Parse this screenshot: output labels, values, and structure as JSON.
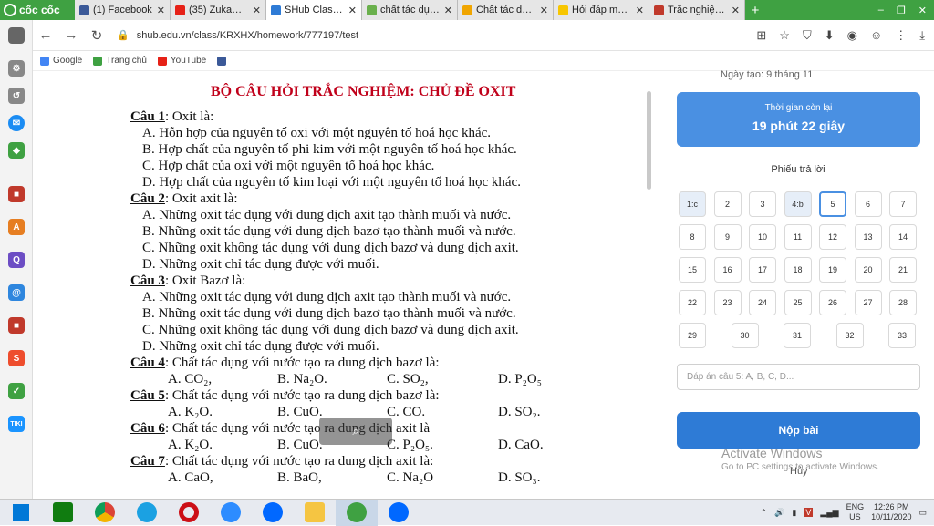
{
  "browser": {
    "brand": "cốc cốc",
    "tabs": [
      {
        "title": "(1) Facebook",
        "icon": "facebook-icon",
        "color": "#3b5998",
        "active": false
      },
      {
        "title": "(35) ZukaNoPro",
        "icon": "youtube-icon",
        "color": "#e62117",
        "active": false
      },
      {
        "title": "SHub Classroom",
        "icon": "shub-icon",
        "color": "#2e7bd6",
        "active": true
      },
      {
        "title": "chất tác dụng v",
        "icon": "leaf-icon",
        "color": "#6ab04c",
        "active": false
      },
      {
        "title": "Chất tác dụng",
        "icon": "tag-icon",
        "color": "#f0a500",
        "active": false
      },
      {
        "title": "Hỏi đáp môn H",
        "icon": "hoidap-icon",
        "color": "#f7c600",
        "active": false
      },
      {
        "title": "Trắc nghiệm: N",
        "icon": "quiz-icon",
        "color": "#c0392b",
        "active": false
      }
    ],
    "new_tab": "+",
    "url": "shub.edu.vn/class/KRXHX/homework/777197/test",
    "bookmarks": [
      {
        "label": "Google",
        "color": "#4285f4"
      },
      {
        "label": "Trang chủ",
        "color": "#3fa142"
      },
      {
        "label": "YouTube",
        "color": "#e62117"
      },
      {
        "label": "",
        "color": "#3b5998"
      }
    ]
  },
  "document": {
    "title": "BỘ CÂU HỎI TRẮC NGHIỆM: CHỦ ĐỀ OXIT",
    "questions": [
      {
        "label": "Câu 1",
        "text": ": Oxit là:",
        "options": [
          "A. Hỗn hợp của nguyên tố oxi với một nguyên tố hoá học khác.",
          "B. Hợp chất của nguyên tố phi kim với một nguyên tố hoá học khác.",
          "C. Hợp chất của oxi với một nguyên tố hoá học khác.",
          "D. Hợp chất của nguyên tố kim loại với một nguyên tố hoá học khác."
        ]
      },
      {
        "label": "Câu 2",
        "text": ": Oxit axit là:",
        "options": [
          "A. Những oxit tác dụng với dung dịch axit tạo thành muối và nước.",
          "B. Những oxit tác dụng với dung dịch bazơ tạo thành muối và nước.",
          "C. Những oxit không tác dụng với dung dịch bazơ và dung dịch axit.",
          "D. Những oxit chỉ tác dụng được với muối."
        ]
      },
      {
        "label": "Câu 3",
        "text": ": Oxit Bazơ là:",
        "options": [
          "A. Những oxit tác dụng với dung dịch axit tạo thành muối và nước.",
          "B. Những oxit tác dụng với dung dịch bazơ tạo thành muối và nước.",
          "C. Những oxit không tác dụng với dung dịch bazơ và dung dịch axit.",
          "D. Những oxit chỉ tác dụng được với muối."
        ]
      },
      {
        "label": "Câu 4",
        "text": ": Chất tác dụng với nước tạo ra dung dịch bazơ là:",
        "options": [
          "A. CO₂,",
          "B. Na₂O.",
          "C. SO₂,",
          "D. P₂O₅"
        ]
      },
      {
        "label": "Câu 5",
        "text": ": Chất tác dụng với nước tạo ra dung dịch bazơ là:",
        "options": [
          "A. K₂O.",
          "B. CuO.",
          "C. CO.",
          "D. SO₂."
        ]
      },
      {
        "label": "Câu 6",
        "text": ": Chất tác dụng với nước tạo ra dung dịch axit là",
        "options": [
          "A. K₂O.",
          "B. CuO.",
          "C. P₂O₅.",
          "D. CaO."
        ]
      },
      {
        "label": "Câu 7",
        "text": ": Chất tác dụng với nước tạo ra dung dịch axit là:",
        "options": [
          "A. CaO,",
          "B. BaO,",
          "C. Na₂O",
          "D. SO₃."
        ]
      }
    ]
  },
  "panel": {
    "created": "Ngày tạo: 9 tháng 11",
    "timer_label": "Thời gian còn lại",
    "timer_value": "19 phút 22 giây",
    "sheet_title": "Phiếu trả lời",
    "cells": [
      "1:c",
      "2",
      "3",
      "4:b",
      "5",
      "6",
      "7",
      "8",
      "9",
      "10",
      "11",
      "12",
      "13",
      "14",
      "15",
      "16",
      "17",
      "18",
      "19",
      "20",
      "21",
      "22",
      "23",
      "24",
      "25",
      "26",
      "27",
      "28",
      "29",
      "30",
      "31",
      "32",
      "33"
    ],
    "answered": [
      "1:c",
      "4:b"
    ],
    "current": "5",
    "answer_placeholder": "Đáp án câu 5: A, B, C, D...",
    "submit": "Nộp bài",
    "cancel": "Hủy",
    "watermark_1": "Activate Windows",
    "watermark_2": "Go to PC settings to activate Windows."
  },
  "taskbar": {
    "lang_1": "ENG",
    "lang_2": "US",
    "time": "12:26 PM",
    "date": "10/11/2020"
  }
}
